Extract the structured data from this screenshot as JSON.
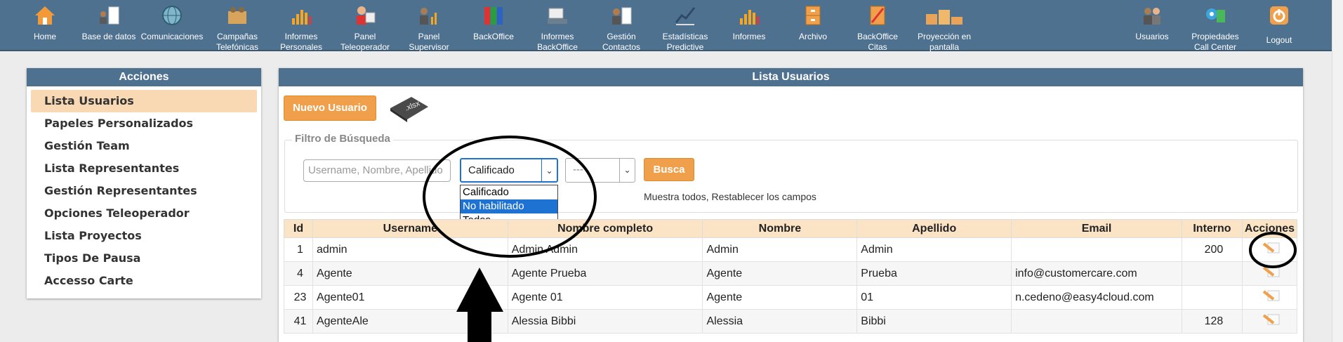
{
  "nav": {
    "left": [
      {
        "label": "Home",
        "icon": "home-icon"
      },
      {
        "label": "Base de datos",
        "icon": "database-icon"
      },
      {
        "label": "Comunicaciones",
        "icon": "globe-icon"
      },
      {
        "label": "Campañas\nTelefónicas",
        "icon": "campaign-icon"
      },
      {
        "label": "Informes\nPersonales",
        "icon": "bar-chart-icon"
      },
      {
        "label": "Panel\nTeleoperador",
        "icon": "operator-icon"
      },
      {
        "label": "Panel\nSupervisor",
        "icon": "supervisor-icon"
      },
      {
        "label": "BackOffice",
        "icon": "binders-icon"
      },
      {
        "label": "Informes\nBackOffice",
        "icon": "keyboard-icon"
      },
      {
        "label": "Gestión\nContactos",
        "icon": "contacts-icon"
      },
      {
        "label": "Estadísticas\nPredictive",
        "icon": "line-chart-icon"
      },
      {
        "label": "Informes",
        "icon": "bar-chart-icon"
      },
      {
        "label": "Archivo",
        "icon": "cabinet-icon"
      },
      {
        "label": "BackOffice\nCitas",
        "icon": "notebook-icon"
      },
      {
        "label": "Proyección en\npantalla",
        "icon": "podium-icon"
      }
    ],
    "right": [
      {
        "label": "Usuarios",
        "icon": "users-icon"
      },
      {
        "label": "Propiedades\nCall Center",
        "icon": "gears-icon"
      },
      {
        "label": "Logout",
        "icon": "power-icon"
      }
    ]
  },
  "sidebar": {
    "title": "Acciones",
    "items": [
      {
        "label": "Lista Usuarios",
        "active": true
      },
      {
        "label": "Papeles Personalizados"
      },
      {
        "label": "Gestión Team"
      },
      {
        "label": "Lista Representantes"
      },
      {
        "label": "Gestión Representantes"
      },
      {
        "label": "Opciones Teleoperador"
      },
      {
        "label": "Lista Proyectos"
      },
      {
        "label": "Tipos De Pausa"
      },
      {
        "label": "Accesso Carte"
      }
    ]
  },
  "main": {
    "title": "Lista Usuarios",
    "new_user_label": "Nuevo Usuario",
    "export_icon_label": ".xlsx",
    "filter": {
      "legend": "Filtro de Búsqueda",
      "search_placeholder": "Username, Nombre, Apellido",
      "status_selected": "Calificado",
      "status_options": [
        "Calificado",
        "No habilitado",
        "Todos"
      ],
      "status_highlighted": "No habilitado",
      "second_selected": "---",
      "search_button": "Busca",
      "hint": "Muestra todos, Restablecer los campos"
    },
    "table": {
      "headers": [
        "Id",
        "Username",
        "Nombre completo",
        "Nombre",
        "Apellido",
        "Email",
        "Interno",
        "Acciones"
      ],
      "rows": [
        [
          "1",
          "admin",
          "Admin Admin",
          "Admin",
          "Admin",
          "",
          "200"
        ],
        [
          "4",
          "Agente",
          "Agente Prueba",
          "Agente",
          "Prueba",
          "info@customercare.com",
          ""
        ],
        [
          "23",
          "Agente01",
          "Agente 01",
          "Agente",
          "01",
          "n.cedeno@easy4cloud.com",
          ""
        ],
        [
          "41",
          "AgenteAle",
          "Alessia Bibbi",
          "Alessia",
          "Bibbi",
          "",
          "128"
        ]
      ]
    }
  },
  "colors": {
    "header_bg": "#4f7190",
    "accent_orange": "#f0a04b",
    "table_header": "#fbe3c6",
    "highlight_blue": "#1e73d2"
  }
}
